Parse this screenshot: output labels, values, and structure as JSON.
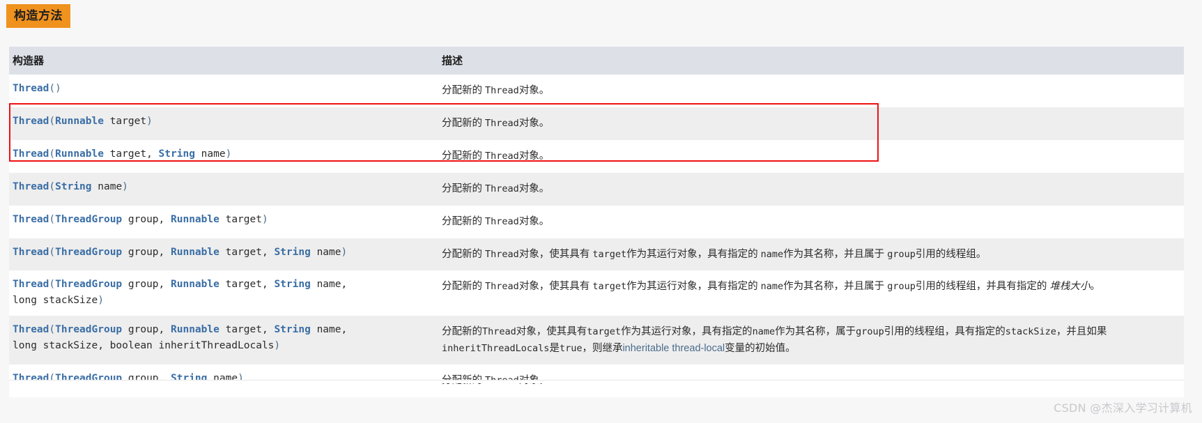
{
  "badge": {
    "label": "构造方法"
  },
  "table": {
    "headers": {
      "sig": "构造器",
      "desc": "描述"
    },
    "rows": [
      {
        "sig_html": "<span class=\"cls\">Thread</span><span class=\"t\">()</span>",
        "sig_text": "Thread()",
        "desc_html": "分配新的 <span class=\"mono\">Thread</span>对象。",
        "desc_text": "分配新的 Thread对象。"
      },
      {
        "sig_html": "<span class=\"cls\">Thread</span><span class=\"t\">(</span><span class=\"cls\">Runnable</span> <span class=\"p\">target</span><span class=\"t\">)</span>",
        "sig_text": "Thread(Runnable target)",
        "desc_html": "分配新的 <span class=\"mono\">Thread</span>对象。",
        "desc_text": "分配新的 Thread对象。"
      },
      {
        "sig_html": "<span class=\"cls\">Thread</span><span class=\"t\">(</span><span class=\"cls\">Runnable</span> <span class=\"p\">target,</span> <span class=\"cls\">String</span> <span class=\"p\">name</span><span class=\"t\">)</span>",
        "sig_text": "Thread(Runnable target, String name)",
        "desc_html": "分配新的 <span class=\"mono\">Thread</span>对象。",
        "desc_text": "分配新的 Thread对象。"
      },
      {
        "sig_html": "<span class=\"cls\">Thread</span><span class=\"t\">(</span><span class=\"cls\">String</span> <span class=\"p\">name</span><span class=\"t\">)</span>",
        "sig_text": "Thread(String name)",
        "desc_html": "分配新的 <span class=\"mono\">Thread</span>对象。",
        "desc_text": "分配新的 Thread对象。"
      },
      {
        "sig_html": "<span class=\"cls\">Thread</span><span class=\"t\">(</span><span class=\"cls\">ThreadGroup</span> <span class=\"p\">group,</span> <span class=\"cls\">Runnable</span> <span class=\"p\">target</span><span class=\"t\">)</span>",
        "sig_text": "Thread(ThreadGroup group, Runnable target)",
        "desc_html": "分配新的 <span class=\"mono\">Thread</span>对象。",
        "desc_text": "分配新的 Thread对象。"
      },
      {
        "sig_html": "<span class=\"cls\">Thread</span><span class=\"t\">(</span><span class=\"cls\">ThreadGroup</span> <span class=\"p\">group,</span> <span class=\"cls\">Runnable</span> <span class=\"p\">target,</span> <span class=\"cls\">String</span> <span class=\"p\">name</span><span class=\"t\">)</span>",
        "sig_text": "Thread(ThreadGroup group, Runnable target, String name)",
        "desc_html": "分配新的 <span class=\"mono\">Thread</span>对象，使其具有 <span class=\"mono\">target</span>作为其运行对象，具有指定的 <span class=\"mono\">name</span>作为其名称，并且属于 <span class=\"mono\">group</span>引用的线程组。",
        "desc_text": "分配新的 Thread对象，使其具有 target作为其运行对象，具有指定的 name作为其名称，并且属于 group引用的线程组。"
      },
      {
        "sig_html": "<span class=\"cls\">Thread</span><span class=\"t\">(</span><span class=\"cls\">ThreadGroup</span> <span class=\"p\">group,</span> <span class=\"cls\">Runnable</span> <span class=\"p\">target,</span> <span class=\"cls\">String</span> <span class=\"p\">name,</span><br><span class=\"p\">long stackSize</span><span class=\"t\">)</span>",
        "sig_text": "Thread(ThreadGroup group, Runnable target, String name, long stackSize)",
        "desc_html": "分配新的 <span class=\"mono\">Thread</span>对象，使其具有 <span class=\"mono\">target</span>作为其运行对象，具有指定的 <span class=\"mono\">name</span>作为其名称，并且属于 <span class=\"mono\">group</span>引用的线程组，并具有指定的 <span class=\"ital\">堆栈大小</span>。",
        "desc_text": "分配新的 Thread对象，使其具有 target作为其运行对象，具有指定的 name作为其名称，并且属于 group引用的线程组，并具有指定的 堆栈大小。"
      },
      {
        "sig_html": "<span class=\"cls\">Thread</span><span class=\"t\">(</span><span class=\"cls\">ThreadGroup</span> <span class=\"p\">group,</span> <span class=\"cls\">Runnable</span> <span class=\"p\">target,</span> <span class=\"cls\">String</span> <span class=\"p\">name,</span><br><span class=\"p\">long stackSize, boolean inheritThreadLocals</span><span class=\"t\">)</span>",
        "sig_text": "Thread(ThreadGroup group, Runnable target, String name, long stackSize, boolean inheritThreadLocals)",
        "desc_html": "分配新的<span class=\"mono\">Thread</span>对象，使其具有<span class=\"mono\">target</span>作为其运行对象，具有指定的<span class=\"mono\">name</span>作为其名称，属于<span class=\"mono\">group</span>引用的线程组，具有指定的<span class=\"mono\">stackSize</span>，并且如果<span class=\"mono\">inheritThreadLocals</span>是<span class=\"mono\">true</span>，则继承<span class=\"lnk\">inheritable thread-local</span>变量的初始值。",
        "desc_text": "分配新的Thread对象，使其具有target作为其运行对象，具有指定的name作为其名称，属于group引用的线程组，具有指定的stackSize，并且如果inheritThreadLocals是true，则继承inheritable thread-local变量的初始值。"
      },
      {
        "sig_html": "<span class=\"cls\">Thread</span><span class=\"t\">(</span><span class=\"cls\">ThreadGroup</span> <span class=\"p\">group,</span> <span class=\"cls\">String</span> <span class=\"p\">name</span><span class=\"t\">)</span>",
        "sig_text": "Thread(ThreadGroup group, String name)",
        "desc_html": "分配新的 <span class=\"mono\">Thread</span>对象。",
        "desc_text": "分配新的 Thread对象。"
      }
    ]
  },
  "highlight": {
    "note": "红框标记",
    "color": "#ee1111"
  },
  "watermark": {
    "text": "CSDN @杰深入学习计算机"
  },
  "colors": {
    "badge_bg": "#f0921e",
    "header_bg": "#dde1e7",
    "row_alt_bg": "#eeeeee",
    "page_bg": "#f7f7f8",
    "type_blue": "#3a6ea5",
    "link_blue": "#4a6c8c"
  }
}
